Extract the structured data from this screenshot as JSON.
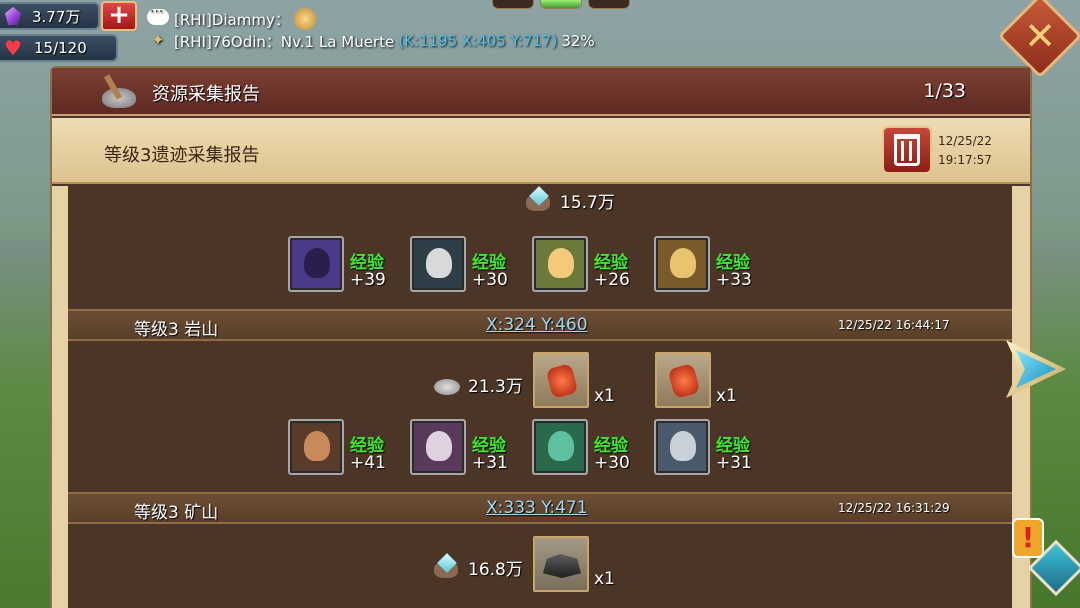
{
  "status": {
    "gems": "3.77万",
    "stamina": "15/120"
  },
  "chat": {
    "line1_text": "[RHI]Diammy：",
    "line2_prefix": "[RHI]76Odin：Nv.1 La Muerte",
    "line2_coords": "(K:1195 X:405 Y:717)",
    "line2_percent": "32%"
  },
  "header": {
    "title": "资源采集报告",
    "page": "1/33"
  },
  "report": {
    "title": "等级3遗迹采集报告",
    "date": "12/25/22",
    "time": "19:17:57"
  },
  "sections": [
    {
      "resource_amount": "15.7万",
      "heroes": [
        {
          "exp_label": "经验",
          "exp_value": "+39",
          "color": "#4b3a8a"
        },
        {
          "exp_label": "经验",
          "exp_value": "+30",
          "color": "#2f3f4a"
        },
        {
          "exp_label": "经验",
          "exp_value": "+26",
          "color": "#6a7a3a"
        },
        {
          "exp_label": "经验",
          "exp_value": "+33",
          "color": "#7a5a2a"
        }
      ]
    },
    {
      "title": "等级3 岩山",
      "coords": "X:324 Y:460",
      "datetime": "12/25/22 16:44:17",
      "resource_amount": "21.3万",
      "items": [
        {
          "qty": "x1",
          "icon": "red-crystal-icon"
        },
        {
          "qty": "x1",
          "icon": "red-crystal-icon"
        }
      ],
      "heroes": [
        {
          "exp_label": "经验",
          "exp_value": "+41",
          "color": "#5a3a2a"
        },
        {
          "exp_label": "经验",
          "exp_value": "+31",
          "color": "#5a3a5a"
        },
        {
          "exp_label": "经验",
          "exp_value": "+30",
          "color": "#2a6a4a"
        },
        {
          "exp_label": "经验",
          "exp_value": "+31",
          "color": "#4a5a6a"
        }
      ]
    },
    {
      "title": "等级3 矿山",
      "coords": "X:333 Y:471",
      "datetime": "12/25/22 16:31:29",
      "resource_amount": "16.8万",
      "items": [
        {
          "qty": "x1",
          "icon": "iron-ore-icon"
        }
      ]
    }
  ]
}
